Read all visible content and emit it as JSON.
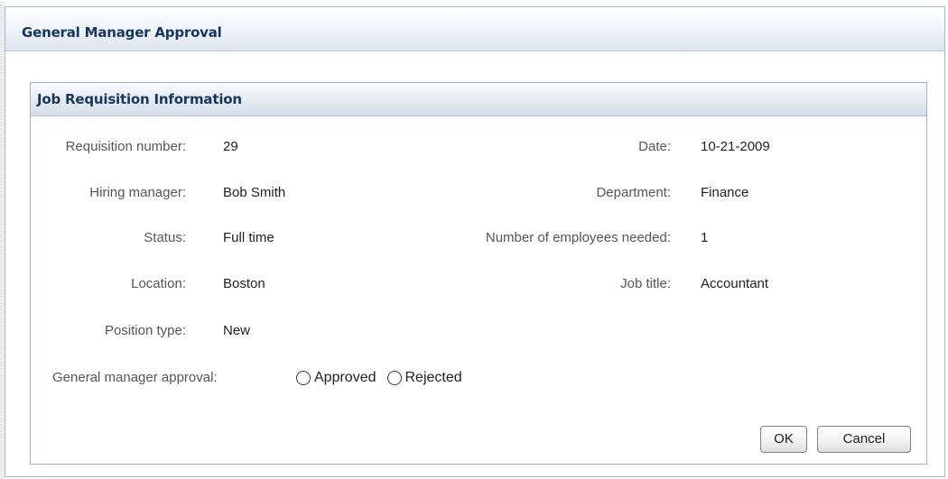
{
  "window": {
    "title": "General Manager Approval"
  },
  "panel": {
    "title": "Job Requisition Information"
  },
  "fields": {
    "requisition_number": {
      "label": "Requisition number:",
      "value": "29"
    },
    "date": {
      "label": "Date:",
      "value": "10-21-2009"
    },
    "hiring_manager": {
      "label": "Hiring manager:",
      "value": "Bob Smith"
    },
    "department": {
      "label": "Department:",
      "value": "Finance"
    },
    "status": {
      "label": "Status:",
      "value": "Full time"
    },
    "employees_needed": {
      "label": "Number of employees needed:",
      "value": "1"
    },
    "location": {
      "label": "Location:",
      "value": "Boston"
    },
    "job_title": {
      "label": "Job title:",
      "value": "Accountant"
    },
    "position_type": {
      "label": "Position type:",
      "value": "New"
    }
  },
  "approval": {
    "label": "General manager approval:",
    "options": [
      {
        "label": "Approved",
        "selected": false
      },
      {
        "label": "Rejected",
        "selected": false
      }
    ]
  },
  "buttons": {
    "ok": "OK",
    "cancel": "Cancel"
  }
}
